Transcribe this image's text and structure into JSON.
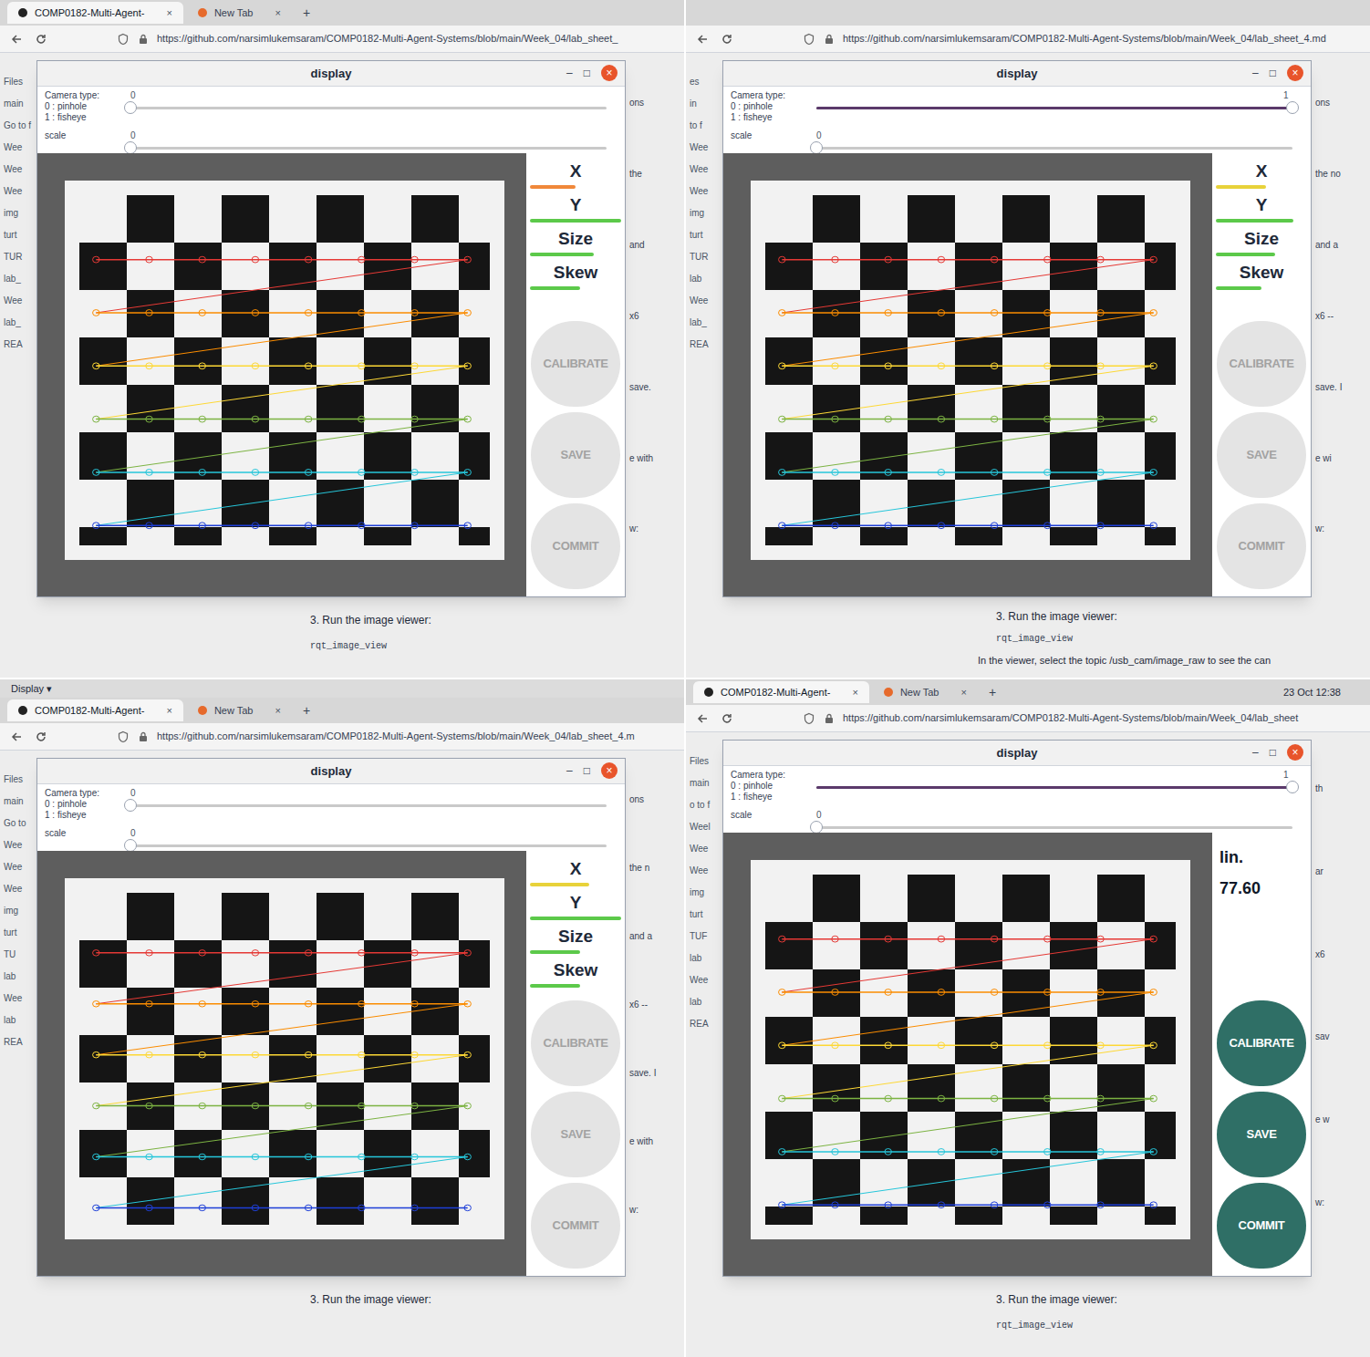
{
  "panels": [
    {
      "browser": {
        "tabs": [
          {
            "label": "COMP0182-Multi-Agent-",
            "selected": true,
            "close": "×"
          },
          {
            "label": "New Tab",
            "selected": false,
            "close": "×"
          }
        ],
        "new_tab": "+",
        "url": "https://github.com/narsimlukemsaram/COMP0182-Multi-Agent-Systems/blob/main/Week_04/lab_sheet_"
      },
      "sidebar": [
        "Files",
        "main",
        "Go to f",
        "Wee",
        "Wee",
        "Wee",
        "img",
        "turt",
        "TUR",
        "lab_",
        "Wee",
        "lab_",
        "REA"
      ],
      "peek": [
        "ons",
        "the",
        "and",
        "x6",
        "save.",
        "e with",
        "w:"
      ],
      "window": {
        "title": "display",
        "controls": [
          "–",
          "□",
          "×"
        ],
        "camera_type": {
          "label": "Camera type:",
          "options": [
            "0 : pinhole",
            "1 : fisheye"
          ],
          "value": "0",
          "level": 0
        },
        "scale": {
          "label": "scale",
          "value": "0",
          "level": 0
        }
      },
      "metrics": [
        {
          "label": "X",
          "level": 0.5,
          "color": "#f0883a"
        },
        {
          "label": "Y",
          "level": 1,
          "color": "#5cc94a"
        },
        {
          "label": "Size",
          "level": 0.7,
          "color": "#5cc94a"
        },
        {
          "label": "Skew",
          "level": 0.55,
          "color": "#5cc94a"
        }
      ],
      "readout": [],
      "buttons": [
        {
          "label": "CALIBRATE",
          "disabled": true
        },
        {
          "label": "SAVE",
          "disabled": true
        },
        {
          "label": "COMMIT",
          "disabled": true
        }
      ],
      "page_text": {
        "step": "3. Run the image viewer:",
        "code": "rqt_image_view"
      }
    },
    {
      "browser": {
        "tabs": [],
        "new_tab": "",
        "url": "https://github.com/narsimlukemsaram/COMP0182-Multi-Agent-Systems/blob/main/Week_04/lab_sheet_4.md"
      },
      "sidebar": [
        "es",
        "in",
        "to f",
        "Wee",
        "Wee",
        "Wee",
        "img",
        "turt",
        "TUR",
        "lab",
        "Wee",
        "lab_",
        "REA"
      ],
      "peek": [
        "ons",
        "the no",
        "and a",
        "x6 --",
        "save. I",
        "e wi",
        "w:"
      ],
      "window": {
        "title": "display",
        "controls": [
          "–",
          "□",
          "×"
        ],
        "camera_type": {
          "label": "Camera type:",
          "options": [
            "0 : pinhole",
            "1 : fisheye"
          ],
          "value": "1",
          "level": 1
        },
        "scale": {
          "label": "scale",
          "value": "0",
          "level": 0
        }
      },
      "metrics": [
        {
          "label": "X",
          "level": 0.55,
          "color": "#e8d23a"
        },
        {
          "label": "Y",
          "level": 0.85,
          "color": "#5cc94a"
        },
        {
          "label": "Size",
          "level": 0.65,
          "color": "#5cc94a"
        },
        {
          "label": "Skew",
          "level": 0.5,
          "color": "#5cc94a"
        }
      ],
      "readout": [],
      "buttons": [
        {
          "label": "CALIBRATE",
          "disabled": true
        },
        {
          "label": "SAVE",
          "disabled": true
        },
        {
          "label": "COMMIT",
          "disabled": true
        }
      ],
      "page_text": {
        "step": "3. Run the image viewer:",
        "code": "rqt_image_view",
        "note": "In the viewer, select the topic /usb_cam/image_raw to see the can"
      }
    },
    {
      "top_label": "Display ▾",
      "browser": {
        "tabs": [
          {
            "label": "COMP0182-Multi-Agent-",
            "selected": true,
            "close": "×"
          },
          {
            "label": "New Tab",
            "selected": false,
            "close": "×"
          }
        ],
        "new_tab": "+",
        "url": "https://github.com/narsimlukemsaram/COMP0182-Multi-Agent-Systems/blob/main/Week_04/lab_sheet_4.m"
      },
      "sidebar": [
        "Files",
        "main",
        "Go to",
        "Wee",
        "Wee",
        "Wee",
        "img",
        "turt",
        "TU",
        "lab",
        "Wee",
        "lab",
        "REA"
      ],
      "peek": [
        "ons",
        "the n",
        "and a",
        "x6 --",
        "save. I",
        "e with",
        "w:"
      ],
      "window": {
        "title": "display",
        "controls": [
          "–",
          "□",
          "×"
        ],
        "camera_type": {
          "label": "Camera type:",
          "options": [
            "0 : pinhole",
            "1 : fisheye"
          ],
          "value": "0",
          "level": 0
        },
        "scale": {
          "label": "scale",
          "value": "0",
          "level": 0
        }
      },
      "metrics": [
        {
          "label": "X",
          "level": 0.65,
          "color": "#e8d23a"
        },
        {
          "label": "Y",
          "level": 1,
          "color": "#5cc94a"
        },
        {
          "label": "Size",
          "level": 0.55,
          "color": "#5cc94a"
        },
        {
          "label": "Skew",
          "level": 0.55,
          "color": "#5cc94a"
        }
      ],
      "readout": [],
      "buttons": [
        {
          "label": "CALIBRATE",
          "disabled": true
        },
        {
          "label": "SAVE",
          "disabled": true
        },
        {
          "label": "COMMIT",
          "disabled": true
        }
      ],
      "page_text": {
        "step": "3. Run the image viewer:"
      }
    },
    {
      "clock": "23 Oct 12:38",
      "browser": {
        "tabs": [
          {
            "label": "COMP0182-Multi-Agent-",
            "selected": true,
            "close": "×"
          },
          {
            "label": "New Tab",
            "selected": false,
            "close": "×"
          }
        ],
        "new_tab": "+",
        "url": "https://github.com/narsimlukemsaram/COMP0182-Multi-Agent-Systems/blob/main/Week_04/lab_sheet"
      },
      "sidebar": [
        "Files",
        "main",
        "o to f",
        "Weel",
        "Wee",
        "Wee",
        "img",
        "turt",
        "TUF",
        "lab",
        "Wee",
        "lab",
        "REA"
      ],
      "peek": [
        "th",
        "ar",
        "x6",
        "sav",
        "e w",
        "w:"
      ],
      "window": {
        "title": "display",
        "controls": [
          "–",
          "□",
          "×"
        ],
        "camera_type": {
          "label": "Camera type:",
          "options": [
            "0 : pinhole",
            "1 : fisheye"
          ],
          "value": "1",
          "level": 1
        },
        "scale": {
          "label": "scale",
          "value": "0",
          "level": 0
        }
      },
      "metrics": [],
      "readout": [
        "lin.",
        "77.60"
      ],
      "buttons": [
        {
          "label": "CALIBRATE",
          "disabled": false
        },
        {
          "label": "SAVE",
          "disabled": false
        },
        {
          "label": "COMMIT",
          "disabled": false
        }
      ],
      "page_text": {
        "step": "3. Run the image viewer:",
        "code": "rqt_image_view"
      }
    }
  ]
}
